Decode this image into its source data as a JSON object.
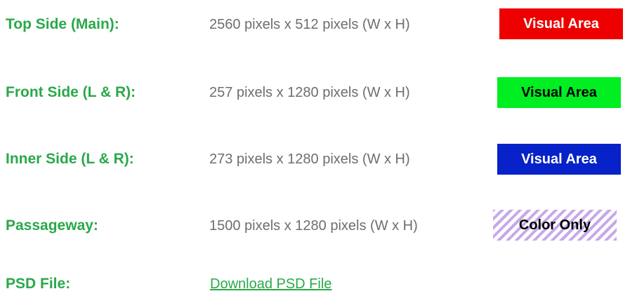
{
  "rows": [
    {
      "label": "Top Side (Main):",
      "dims": "2560 pixels x 512 pixels (W x H)",
      "badge": "Visual Area",
      "badge_color": "#ee0000"
    },
    {
      "label": "Front Side (L & R):",
      "dims": "257 pixels x 1280 pixels (W x H)",
      "badge": "Visual Area",
      "badge_color": "#00ee22"
    },
    {
      "label": "Inner Side (L & R):",
      "dims": "273 pixels x 1280 pixels (W x H)",
      "badge": "Visual Area",
      "badge_color": "#0622c8"
    },
    {
      "label": "Passageway:",
      "dims": "1500 pixels x 1280 pixels (W x H)",
      "badge": "Color Only",
      "badge_pattern_color": "#c7a8e8"
    }
  ],
  "psd": {
    "label": "PSD File:",
    "link_text": "Download PSD File"
  },
  "colors": {
    "label_green": "#2aa84a",
    "dims_gray": "#6e6e6e"
  }
}
